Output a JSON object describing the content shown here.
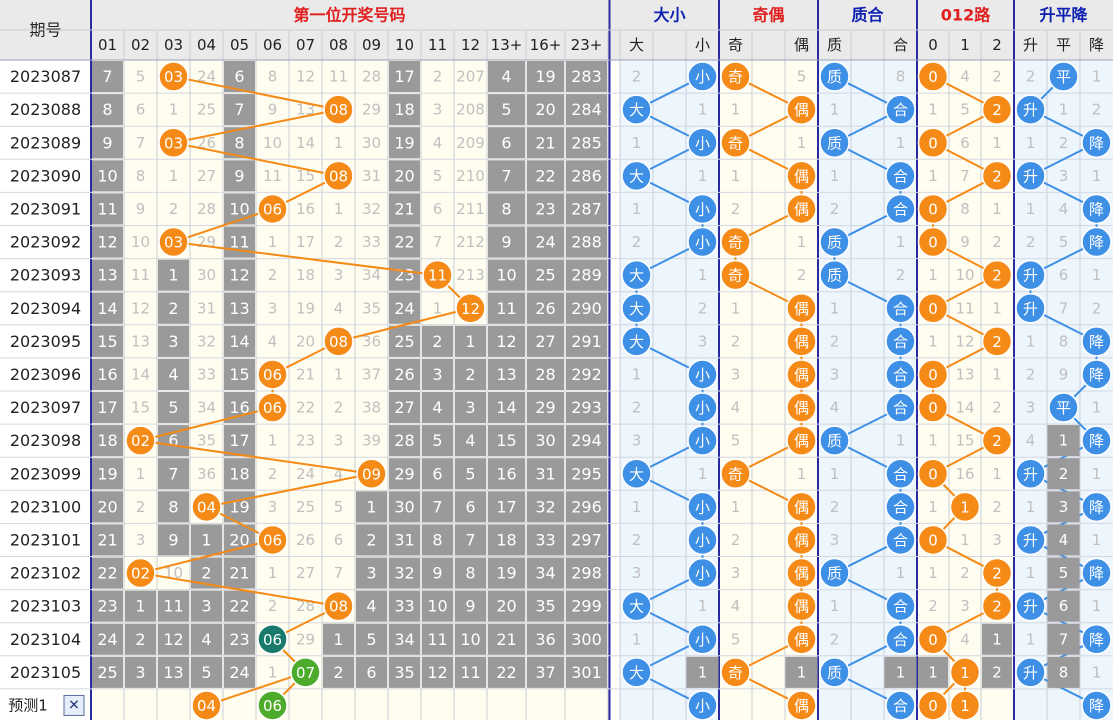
{
  "header": {
    "period_label": "期号",
    "group_titles": [
      "第一位开奖号码",
      "大小",
      "奇偶",
      "质合",
      "012路",
      "升平降"
    ],
    "sub_columns": [
      "01",
      "02",
      "03",
      "04",
      "05",
      "06",
      "07",
      "08",
      "09",
      "10",
      "11",
      "12",
      "13+",
      "16+",
      "23+",
      "大",
      "小",
      "奇",
      "偶",
      "质",
      "合",
      "0",
      "1",
      "2",
      "升",
      "平",
      "降"
    ]
  },
  "colors": {
    "accent_red": "#e02020",
    "accent_blue": "#0c1fb0",
    "orange_ball": "#f58a16",
    "blue_ball": "#3e8fe6",
    "teal_ball": "#177a6a",
    "green_ball": "#4cab2a",
    "grey_cell": "#9a9a9a"
  },
  "rows": [
    {
      "period": "2023087",
      "num": 3,
      "f1": [
        7,
        5,
        3,
        24,
        6,
        8,
        12,
        11,
        28,
        17,
        2,
        207
      ],
      "f2": [
        4,
        19,
        283
      ],
      "size": "小",
      "size_miss": 2,
      "parity": "奇",
      "parity_miss": 5,
      "prime": "质",
      "prime_miss": 8,
      "road": 0,
      "road_miss": [
        4,
        2
      ],
      "trend": "平",
      "trend_miss": [
        2,
        1
      ]
    },
    {
      "period": "2023088",
      "num": 8,
      "f1": [
        8,
        6,
        1,
        25,
        7,
        9,
        13,
        8,
        29,
        18,
        3,
        208
      ],
      "f2": [
        5,
        20,
        284
      ],
      "size": "大",
      "size_miss": 1,
      "parity": "偶",
      "parity_miss": 1,
      "prime": "合",
      "prime_miss": 1,
      "road": 2,
      "road_miss": [
        1,
        5
      ],
      "trend": "升",
      "trend_miss": [
        1,
        2
      ]
    },
    {
      "period": "2023089",
      "num": 3,
      "f1": [
        9,
        7,
        3,
        26,
        8,
        10,
        14,
        1,
        30,
        19,
        4,
        209
      ],
      "f2": [
        6,
        21,
        285
      ],
      "size": "小",
      "size_miss": 1,
      "parity": "奇",
      "parity_miss": 1,
      "prime": "质",
      "prime_miss": 1,
      "road": 0,
      "road_miss": [
        6,
        1
      ],
      "trend": "降",
      "trend_miss": [
        1,
        2
      ]
    },
    {
      "period": "2023090",
      "num": 8,
      "f1": [
        10,
        8,
        1,
        27,
        9,
        11,
        15,
        8,
        31,
        20,
        5,
        210
      ],
      "f2": [
        7,
        22,
        286
      ],
      "size": "大",
      "size_miss": 1,
      "parity": "偶",
      "parity_miss": 1,
      "prime": "合",
      "prime_miss": 1,
      "road": 2,
      "road_miss": [
        1,
        7
      ],
      "trend": "升",
      "trend_miss": [
        3,
        1
      ]
    },
    {
      "period": "2023091",
      "num": 6,
      "f1": [
        11,
        9,
        2,
        28,
        10,
        6,
        16,
        1,
        32,
        21,
        6,
        211
      ],
      "f2": [
        8,
        23,
        287
      ],
      "size": "小",
      "size_miss": 1,
      "parity": "偶",
      "parity_miss": 2,
      "prime": "合",
      "prime_miss": 2,
      "road": 0,
      "road_miss": [
        8,
        1
      ],
      "trend": "降",
      "trend_miss": [
        1,
        4
      ]
    },
    {
      "period": "2023092",
      "num": 3,
      "f1": [
        12,
        10,
        3,
        29,
        11,
        1,
        17,
        2,
        33,
        22,
        7,
        212
      ],
      "f2": [
        9,
        24,
        288
      ],
      "size": "小",
      "size_miss": 2,
      "parity": "奇",
      "parity_miss": 1,
      "prime": "质",
      "prime_miss": 1,
      "road": 0,
      "road_miss": [
        9,
        2
      ],
      "trend": "降",
      "trend_miss": [
        2,
        5
      ]
    },
    {
      "period": "2023093",
      "num": 11,
      "f1": [
        13,
        11,
        1,
        30,
        12,
        2,
        18,
        3,
        34,
        23,
        11,
        213
      ],
      "f2": [
        10,
        25,
        289
      ],
      "size": "大",
      "size_miss": 1,
      "parity": "奇",
      "parity_miss": 2,
      "prime": "质",
      "prime_miss": 2,
      "road": 2,
      "road_miss": [
        1,
        10
      ],
      "trend": "升",
      "trend_miss": [
        6,
        1
      ]
    },
    {
      "period": "2023094",
      "num": 12,
      "f1": [
        14,
        12,
        2,
        31,
        13,
        3,
        19,
        4,
        35,
        24,
        1,
        12
      ],
      "f2": [
        11,
        26,
        290
      ],
      "size": "大",
      "size_miss": 2,
      "parity": "偶",
      "parity_miss": 1,
      "prime": "合",
      "prime_miss": 1,
      "road": 0,
      "road_miss": [
        11,
        1
      ],
      "trend": "升",
      "trend_miss": [
        7,
        2
      ]
    },
    {
      "period": "2023095",
      "num": 8,
      "f1": [
        15,
        13,
        3,
        32,
        14,
        4,
        20,
        8,
        36,
        25,
        2,
        1
      ],
      "f2": [
        12,
        27,
        291
      ],
      "size": "大",
      "size_miss": 3,
      "parity": "偶",
      "parity_miss": 2,
      "prime": "合",
      "prime_miss": 2,
      "road": 2,
      "road_miss": [
        1,
        12
      ],
      "trend": "降",
      "trend_miss": [
        1,
        8
      ]
    },
    {
      "period": "2023096",
      "num": 6,
      "f1": [
        16,
        14,
        4,
        33,
        15,
        6,
        21,
        1,
        37,
        26,
        3,
        2
      ],
      "f2": [
        13,
        28,
        292
      ],
      "size": "小",
      "size_miss": 1,
      "parity": "偶",
      "parity_miss": 3,
      "prime": "合",
      "prime_miss": 3,
      "road": 0,
      "road_miss": [
        13,
        1
      ],
      "trend": "降",
      "trend_miss": [
        2,
        9
      ]
    },
    {
      "period": "2023097",
      "num": 6,
      "f1": [
        17,
        15,
        5,
        34,
        16,
        6,
        22,
        2,
        38,
        27,
        4,
        3
      ],
      "f2": [
        14,
        29,
        293
      ],
      "size": "小",
      "size_miss": 2,
      "parity": "偶",
      "parity_miss": 4,
      "prime": "合",
      "prime_miss": 4,
      "road": 0,
      "road_miss": [
        14,
        2
      ],
      "trend": "平",
      "trend_miss": [
        3,
        1
      ]
    },
    {
      "period": "2023098",
      "num": 2,
      "f1": [
        18,
        2,
        6,
        35,
        17,
        1,
        23,
        3,
        39,
        28,
        5,
        4
      ],
      "f2": [
        15,
        30,
        294
      ],
      "size": "小",
      "size_miss": 3,
      "parity": "偶",
      "parity_miss": 5,
      "prime": "质",
      "prime_miss": 1,
      "road": 2,
      "road_miss": [
        1,
        15
      ],
      "trend": "降",
      "trend_miss": [
        4,
        1
      ]
    },
    {
      "period": "2023099",
      "num": 9,
      "f1": [
        19,
        1,
        7,
        36,
        18,
        2,
        24,
        4,
        9,
        29,
        6,
        5
      ],
      "f2": [
        16,
        31,
        295
      ],
      "size": "大",
      "size_miss": 1,
      "parity": "奇",
      "parity_miss": 1,
      "prime": "合",
      "prime_miss": 1,
      "road": 0,
      "road_miss": [
        16,
        1
      ],
      "trend": "升",
      "trend_miss": [
        2,
        1
      ]
    },
    {
      "period": "2023100",
      "num": 4,
      "f1": [
        20,
        2,
        8,
        4,
        19,
        3,
        25,
        5,
        1,
        30,
        7,
        6
      ],
      "f2": [
        17,
        32,
        296
      ],
      "size": "小",
      "size_miss": 1,
      "parity": "偶",
      "parity_miss": 1,
      "prime": "合",
      "prime_miss": 2,
      "road": 1,
      "road_miss": [
        1,
        2
      ],
      "trend": "降",
      "trend_miss": [
        1,
        3
      ]
    },
    {
      "period": "2023101",
      "num": 6,
      "f1": [
        21,
        3,
        9,
        1,
        20,
        6,
        26,
        6,
        2,
        31,
        8,
        7
      ],
      "f2": [
        18,
        33,
        297
      ],
      "size": "小",
      "size_miss": 2,
      "parity": "偶",
      "parity_miss": 2,
      "prime": "合",
      "prime_miss": 3,
      "road": 0,
      "road_miss": [
        1,
        3
      ],
      "trend": "升",
      "trend_miss": [
        4,
        1
      ]
    },
    {
      "period": "2023102",
      "num": 2,
      "f1": [
        22,
        2,
        10,
        2,
        21,
        1,
        27,
        7,
        3,
        32,
        9,
        8
      ],
      "f2": [
        19,
        34,
        298
      ],
      "size": "小",
      "size_miss": 3,
      "parity": "偶",
      "parity_miss": 3,
      "prime": "质",
      "prime_miss": 1,
      "road": 2,
      "road_miss": [
        1,
        2
      ],
      "trend": "降",
      "trend_miss": [
        1,
        5
      ]
    },
    {
      "period": "2023103",
      "num": 8,
      "f1": [
        23,
        1,
        11,
        3,
        22,
        2,
        28,
        8,
        4,
        33,
        10,
        9
      ],
      "f2": [
        20,
        35,
        299
      ],
      "size": "大",
      "size_miss": 1,
      "parity": "偶",
      "parity_miss": 4,
      "prime": "合",
      "prime_miss": 1,
      "road": 2,
      "road_miss": [
        2,
        3
      ],
      "trend": "升",
      "trend_miss": [
        6,
        1
      ]
    },
    {
      "period": "2023104",
      "num": 6,
      "f1": [
        24,
        2,
        12,
        4,
        23,
        6,
        29,
        1,
        5,
        34,
        11,
        10
      ],
      "f2": [
        21,
        36,
        300
      ],
      "size": "小",
      "size_miss": 1,
      "parity": "偶",
      "parity_miss": 5,
      "prime": "合",
      "prime_miss": 2,
      "road": 0,
      "road_miss": [
        4,
        1
      ],
      "trend": "降",
      "trend_miss": [
        1,
        7
      ]
    },
    {
      "period": "2023105",
      "num": 7,
      "f1": [
        25,
        3,
        13,
        5,
        24,
        1,
        7,
        2,
        6,
        35,
        12,
        11
      ],
      "f2": [
        22,
        37,
        301
      ],
      "size": "大",
      "size_miss": 1,
      "parity": "奇",
      "parity_miss": 1,
      "prime": "质",
      "prime_miss": 1,
      "road": 1,
      "road_miss": [
        1,
        2
      ],
      "trend": "升",
      "trend_miss": [
        8,
        1
      ]
    }
  ],
  "predict": {
    "label": "预测1",
    "close_symbol": "✕",
    "numbers": [
      4,
      6
    ],
    "size": "小",
    "parity": "偶",
    "prime": "合",
    "roads": [
      0,
      1
    ],
    "trend": "降"
  },
  "chart_data": {
    "type": "table",
    "title": "第一位开奖号码",
    "periods": [
      "2023087",
      "2023088",
      "2023089",
      "2023090",
      "2023091",
      "2023092",
      "2023093",
      "2023094",
      "2023095",
      "2023096",
      "2023097",
      "2023098",
      "2023099",
      "2023100",
      "2023101",
      "2023102",
      "2023103",
      "2023104",
      "2023105"
    ],
    "first_digit": [
      3,
      8,
      3,
      8,
      6,
      3,
      11,
      12,
      8,
      6,
      6,
      2,
      9,
      4,
      6,
      2,
      8,
      6,
      7
    ],
    "size": [
      "小",
      "大",
      "小",
      "大",
      "小",
      "小",
      "大",
      "大",
      "大",
      "小",
      "小",
      "小",
      "大",
      "小",
      "小",
      "小",
      "大",
      "小",
      "大"
    ],
    "parity": [
      "奇",
      "偶",
      "奇",
      "偶",
      "偶",
      "奇",
      "奇",
      "偶",
      "偶",
      "偶",
      "偶",
      "偶",
      "奇",
      "偶",
      "偶",
      "偶",
      "偶",
      "偶",
      "奇"
    ],
    "prime_composite": [
      "质",
      "合",
      "质",
      "合",
      "合",
      "质",
      "质",
      "合",
      "合",
      "合",
      "合",
      "质",
      "合",
      "合",
      "合",
      "质",
      "合",
      "合",
      "质"
    ],
    "road_012": [
      0,
      2,
      0,
      2,
      0,
      0,
      2,
      0,
      2,
      0,
      0,
      2,
      0,
      1,
      0,
      2,
      2,
      0,
      1
    ],
    "trend": [
      "平",
      "升",
      "降",
      "升",
      "降",
      "降",
      "升",
      "升",
      "降",
      "降",
      "平",
      "降",
      "升",
      "降",
      "升",
      "降",
      "升",
      "降",
      "升"
    ],
    "prediction": {
      "numbers": [
        4,
        6
      ],
      "size": "小",
      "parity": "偶",
      "prime": "合",
      "road": [
        0,
        1
      ],
      "trend": "降"
    }
  }
}
